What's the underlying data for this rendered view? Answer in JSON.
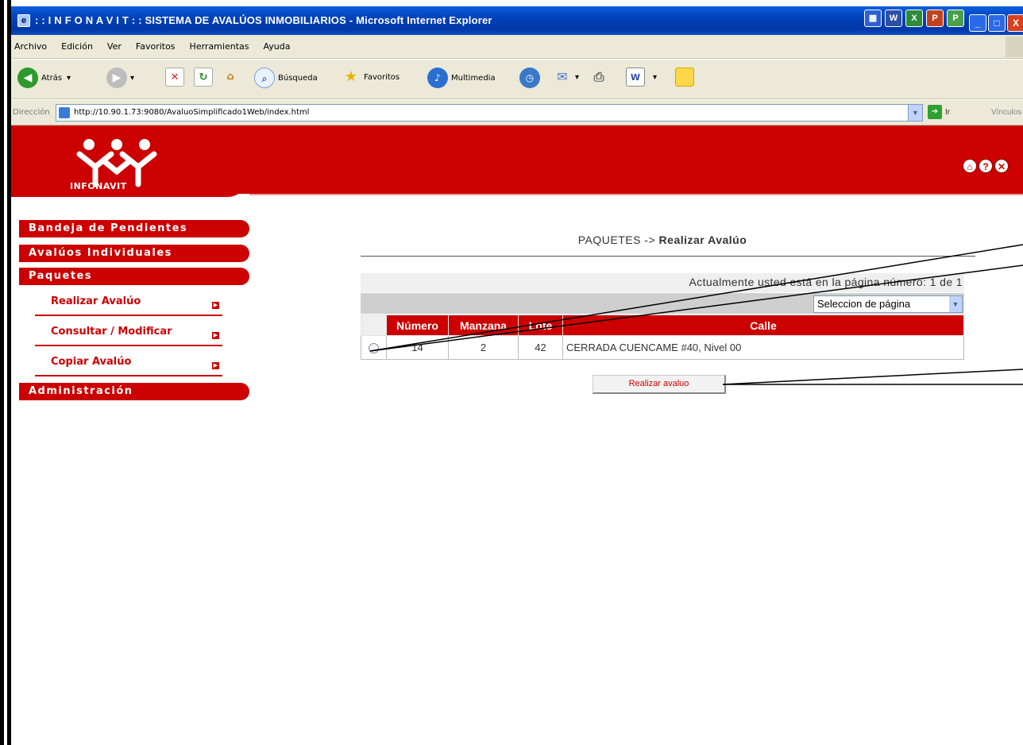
{
  "window": {
    "title": ": : I N F O N A V I T : : SISTEMA DE AVALÚOS INMOBILIARIOS - Microsoft Internet Explorer"
  },
  "menu": [
    "Archivo",
    "Edición",
    "Ver",
    "Favoritos",
    "Herramientas",
    "Ayuda"
  ],
  "toolbar": {
    "back": "Atrás",
    "search": "Búsqueda",
    "favorites": "Favoritos",
    "multimedia": "Multimedia"
  },
  "address": {
    "label": "Dirección",
    "url": "http://10.90.1.73:9080/AvaluoSimplificado1Web/index.html",
    "go": "Ir",
    "links": "Vínculos"
  },
  "header": {
    "brand": "INFONAVIT",
    "icons": [
      "home-icon",
      "help-icon",
      "close-icon"
    ]
  },
  "sidebar": {
    "sections": [
      {
        "label": "Bandeja de Pendientes"
      },
      {
        "label": "Avalúos Individuales"
      },
      {
        "label": "Paquetes"
      },
      {
        "label": "Administración"
      }
    ],
    "subitems": [
      {
        "label": "Realizar Avalúo"
      },
      {
        "label": "Consultar / Modificar"
      },
      {
        "label": "Copiar Avalúo"
      }
    ]
  },
  "breadcrumb": {
    "prefix": "PAQUETES ->",
    "current": "Realizar Avalúo"
  },
  "paging": {
    "status": "Actualmente usted está en la página número: 1 de 1",
    "select_value": "Seleccion de página"
  },
  "table": {
    "headers": [
      "Número",
      "Manzana",
      "Lote",
      "Calle"
    ],
    "rows": [
      {
        "numero": "14",
        "manzana": "2",
        "lote": "42",
        "calle": "CERRADA CUENCAME #40, Nivel 00"
      }
    ]
  },
  "action": {
    "label": "Realizar avaluo"
  },
  "colors": {
    "brand_red": "#cc0000",
    "titlebar_blue": "#0242b8"
  }
}
